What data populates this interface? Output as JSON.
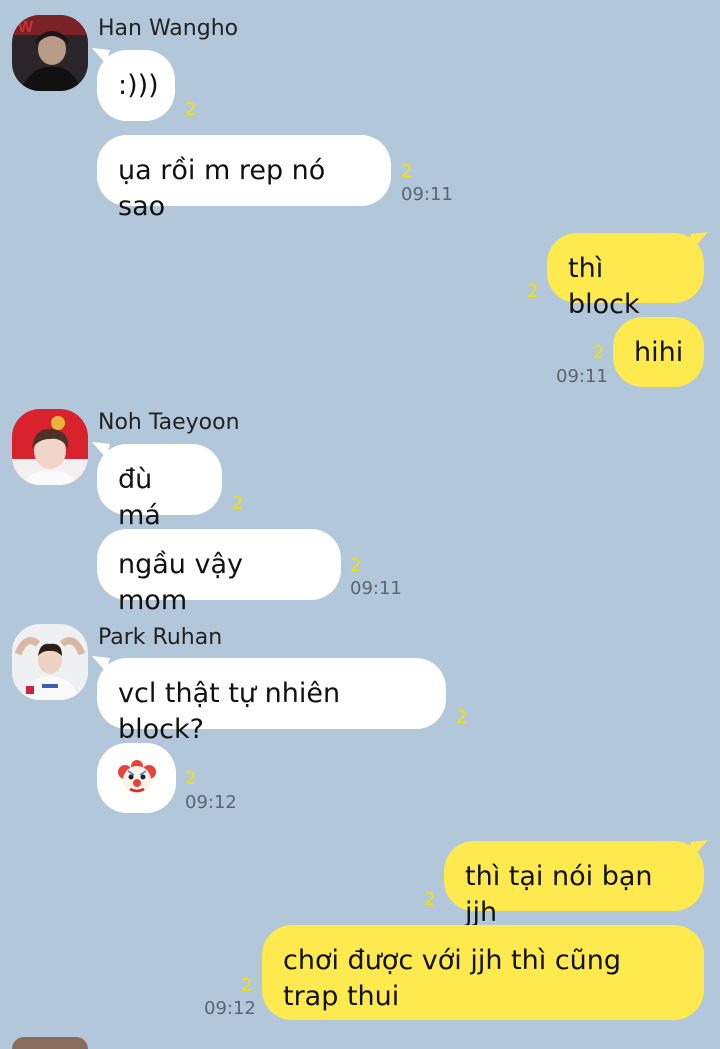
{
  "messages": {
    "m1": {
      "sender": "Han Wangho",
      "text": ":)))",
      "unread": "2"
    },
    "m2": {
      "text": "ụa rồi m rep nó sao",
      "unread": "2",
      "time": "09:11"
    },
    "m3": {
      "text": "thì block",
      "unread": "2"
    },
    "m4": {
      "text": "hihi",
      "unread": "2",
      "time": "09:11"
    },
    "m5": {
      "sender": "Noh Taeyoon",
      "text": "đù má",
      "unread": "2"
    },
    "m6": {
      "text": "ngầu vậy mom",
      "unread": "2",
      "time": "09:11"
    },
    "m7": {
      "sender": "Park Ruhan",
      "text": "vcl thật tự nhiên block?",
      "unread": "2"
    },
    "m8": {
      "emoji": "clown-face-emoji",
      "unread": "2",
      "time": "09:12"
    },
    "m9": {
      "text": "thì tại nói bạn jjh",
      "unread": "2"
    },
    "m10": {
      "text": "chơi được với jjh thì cũng trap thui",
      "unread": "2",
      "time": "09:12"
    }
  },
  "colors": {
    "background": "#b2c7da",
    "incoming_bubble": "#ffffff",
    "outgoing_bubble": "#fee94e",
    "unread_count": "#f2e000",
    "timestamp": "#5a6570"
  }
}
